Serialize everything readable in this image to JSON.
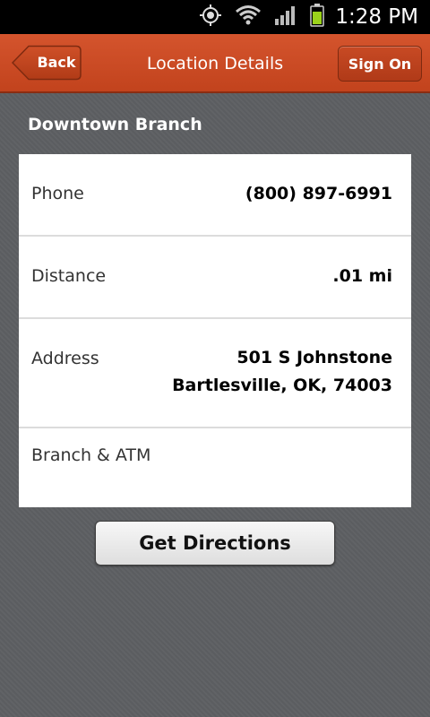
{
  "status_bar": {
    "time": "1:28 PM",
    "icons": [
      "gps-icon",
      "wifi-icon",
      "signal-icon",
      "battery-icon"
    ]
  },
  "header": {
    "back_label": "Back",
    "title": "Location Details",
    "sign_on_label": "Sign On"
  },
  "branch": {
    "name": "Downtown Branch"
  },
  "details": {
    "phone": {
      "label": "Phone",
      "value": "(800) 897-6991"
    },
    "distance": {
      "label": "Distance",
      "value": ".01 mi"
    },
    "address": {
      "label": "Address",
      "line1": "501 S Johnstone",
      "line2": "Bartlesville, OK, 74003"
    },
    "type": {
      "label": "Branch & ATM"
    }
  },
  "actions": {
    "directions_label": "Get Directions"
  },
  "colors": {
    "header": "#c94a23",
    "background": "#5d5f62",
    "battery": "#9bd21b"
  }
}
